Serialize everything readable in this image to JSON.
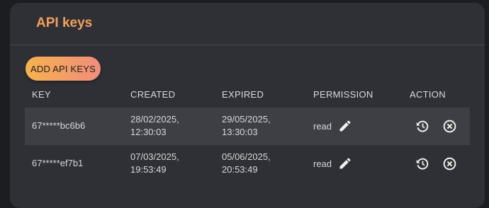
{
  "panel": {
    "title": "API keys",
    "add_button_label": "ADD API KEYS"
  },
  "table": {
    "columns": [
      "KEY",
      "CREATED",
      "EXPIRED",
      "PERMISSION",
      "ACTION"
    ],
    "rows": [
      {
        "key": "67*****bc6b6",
        "created_date": "28/02/2025,",
        "created_time": "12:30:03",
        "expired_date": "29/05/2025,",
        "expired_time": "13:30:03",
        "permission": "read"
      },
      {
        "key": "67*****ef7b1",
        "created_date": "07/03/2025,",
        "created_time": "19:53:49",
        "expired_date": "05/06/2025,",
        "expired_time": "20:53:49",
        "permission": "read"
      }
    ]
  },
  "icons": {
    "edit": "pencil-icon",
    "renew": "history-icon",
    "revoke": "circle-x-icon"
  },
  "colors": {
    "title": "#f2a15b",
    "button_gradient_start": "#f6b24e",
    "button_gradient_end": "#f08d7c",
    "panel_bg": "#2e3035",
    "row_highlight": "#3d3f45"
  }
}
